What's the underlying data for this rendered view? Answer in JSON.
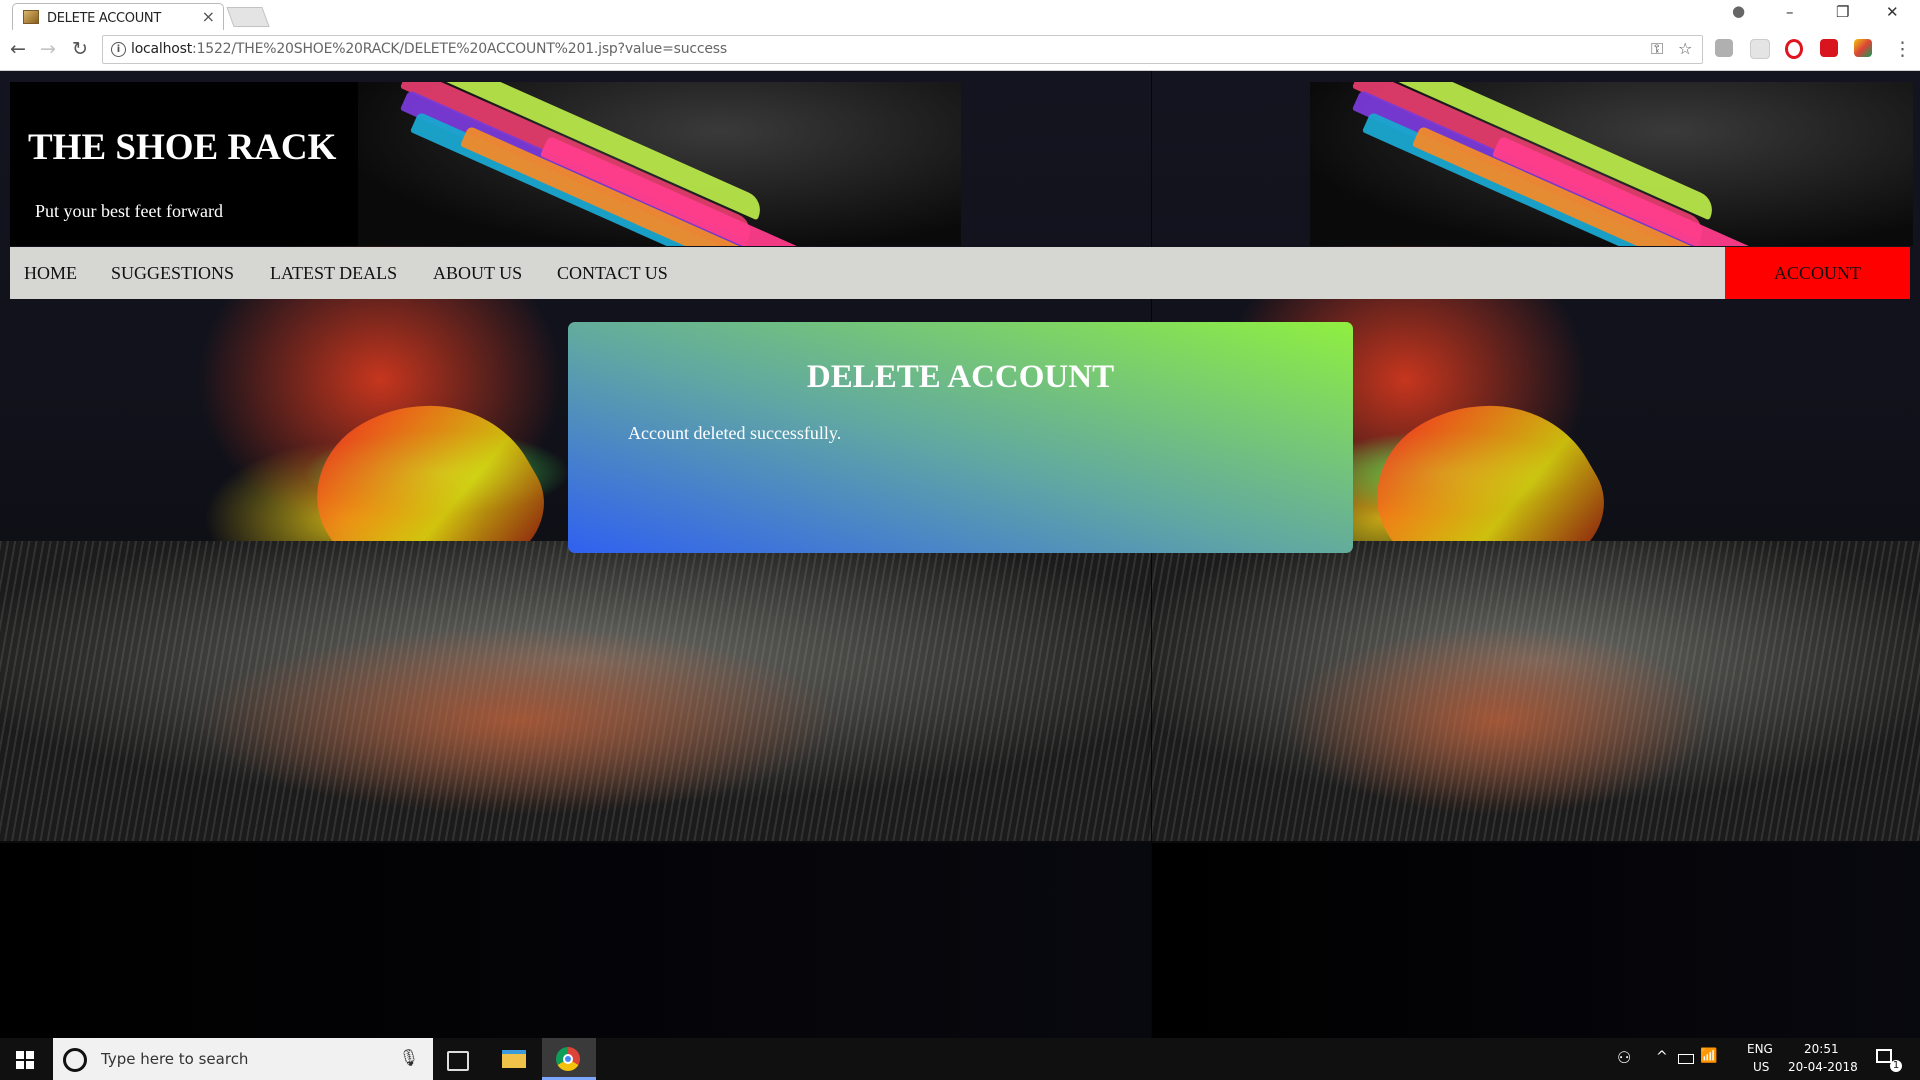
{
  "browser": {
    "tab_title": "DELETE ACCOUNT",
    "tab_close": "×",
    "url_host": "localhost",
    "url_rest": ":1522/THE%20SHOE%20RACK/DELETE%20ACCOUNT%201.jsp?value=success",
    "back_glyph": "←",
    "forward_glyph": "→",
    "reload_glyph": "↻",
    "info_glyph": "i",
    "key_glyph": "⚿",
    "star_glyph": "☆",
    "menu_glyph": "⋮",
    "min_glyph": "–",
    "restore_glyph": "❐",
    "close_glyph": "✕",
    "profile_glyph": "●"
  },
  "site": {
    "title": "THE SHOE RACK",
    "tagline": "Put your best feet forward"
  },
  "nav": {
    "items": [
      "HOME",
      "SUGGESTIONS",
      "LATEST DEALS",
      "ABOUT US",
      "CONTACT US"
    ],
    "account": "ACCOUNT",
    "account_color": "#ff0000"
  },
  "message": {
    "title": "DELETE ACCOUNT",
    "text": "Account deleted successfully."
  },
  "taskbar": {
    "search_placeholder": "Type here to search",
    "language": "ENG",
    "region": "US",
    "time": "20:51",
    "date": "20-04-2018",
    "notification_count": "1"
  },
  "icons": [
    "windows-start-icon",
    "cortana-icon",
    "microphone-icon",
    "task-view-icon",
    "file-explorer-icon",
    "chrome-icon",
    "people-icon",
    "chevron-up-icon",
    "battery-icon",
    "network-icon",
    "notification-icon"
  ]
}
